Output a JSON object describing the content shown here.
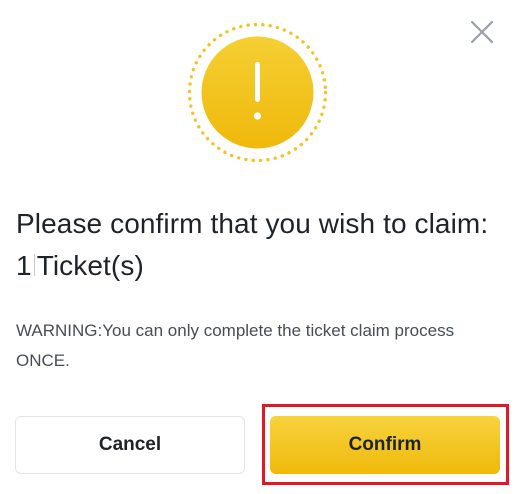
{
  "dialog": {
    "close_icon": "close-icon",
    "warning_icon": "exclamation-icon",
    "title_part1": "Please confirm that you wish to claim: 1",
    "title_part2": "Ticket(s)",
    "warning_text": "WARNING:You can only complete the ticket claim process ONCE.",
    "cancel_label": "Cancel",
    "confirm_label": "Confirm"
  },
  "colors": {
    "accent_yellow": "#F0B90B",
    "highlight_red": "#E01A22",
    "text_primary": "#1E2329",
    "text_secondary": "#474D57"
  }
}
